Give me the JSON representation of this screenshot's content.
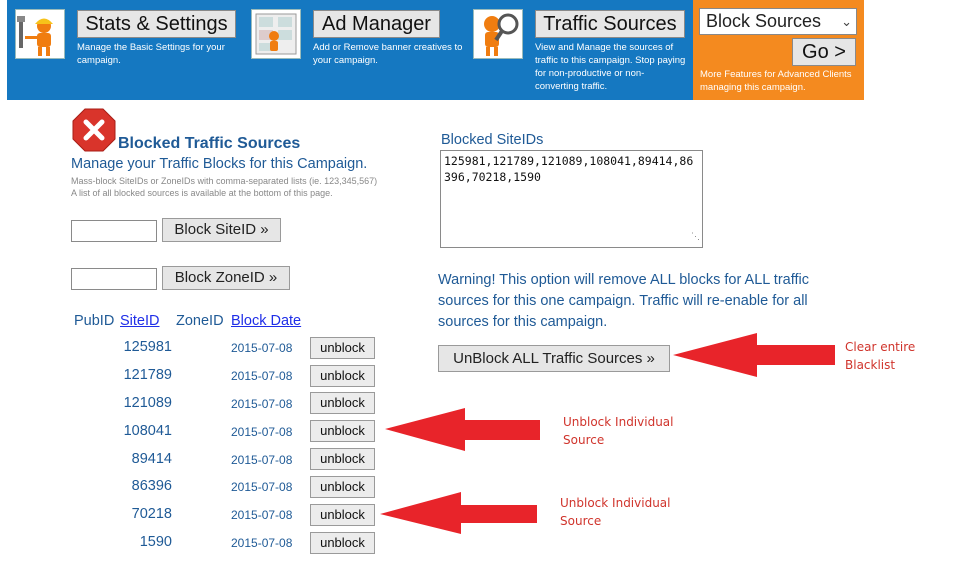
{
  "nav": {
    "items": [
      {
        "label": "Stats & Settings",
        "desc": "Manage the Basic Settings for your campaign."
      },
      {
        "label": "Ad Manager",
        "desc": "Add or Remove banner creatives to your campaign."
      },
      {
        "label": "Traffic Sources",
        "desc": "View and Manage the sources of traffic to this campaign. Stop paying for non-productive or non-converting traffic."
      }
    ],
    "more": {
      "select_value": "Block Sources",
      "go_label": "Go >",
      "desc": "More Features for Advanced Clients managing this campaign."
    }
  },
  "page": {
    "title": "Blocked Traffic Sources",
    "subtitle": "Manage your Traffic Blocks for this Campaign.",
    "hint1": "Mass-block SiteIDs or ZoneIDs with comma-separated lists (ie. 123,345,567)",
    "hint2": "A list of all blocked sources is available at the bottom of this page.",
    "block_siteid_label": "Block SiteID »",
    "block_zoneid_label": "Block ZoneID »"
  },
  "table": {
    "headers": {
      "pubid": "PubID",
      "siteid": "SiteID",
      "zoneid": "ZoneID",
      "date": "Block Date"
    },
    "unblock_label": "unblock",
    "rows": [
      {
        "siteid": "125981",
        "date": "2015-07-08"
      },
      {
        "siteid": "121789",
        "date": "2015-07-08"
      },
      {
        "siteid": "121089",
        "date": "2015-07-08"
      },
      {
        "siteid": "108041",
        "date": "2015-07-08"
      },
      {
        "siteid": "89414",
        "date": "2015-07-08"
      },
      {
        "siteid": "86396",
        "date": "2015-07-08"
      },
      {
        "siteid": "70218",
        "date": "2015-07-08"
      },
      {
        "siteid": "1590",
        "date": "2015-07-08"
      }
    ]
  },
  "blocked": {
    "label": "Blocked SiteIDs",
    "value": "125981,121789,121089,108041,89414,86396,70218,1590"
  },
  "warning": {
    "text": "Warning! This option will remove ALL blocks for ALL traffic sources for this one campaign. Traffic will re-enable for all sources for this campaign.",
    "unblock_all_label": "UnBlock ALL Traffic Sources »"
  },
  "annotations": {
    "clear_line1": "Clear entire",
    "clear_line2": "Blacklist",
    "unblock1_line1": "Unblock Individual",
    "unblock1_line2": "Source",
    "unblock2_line1": "Unblock Individual",
    "unblock2_line2": "Source"
  },
  "colors": {
    "nav_blue": "#1578c1",
    "nav_orange": "#f48a1f",
    "text_blue": "#1f5a96",
    "link_blue": "#1f2ee8",
    "arrow_red": "#e8242a",
    "annotation_red": "#d0342c"
  }
}
